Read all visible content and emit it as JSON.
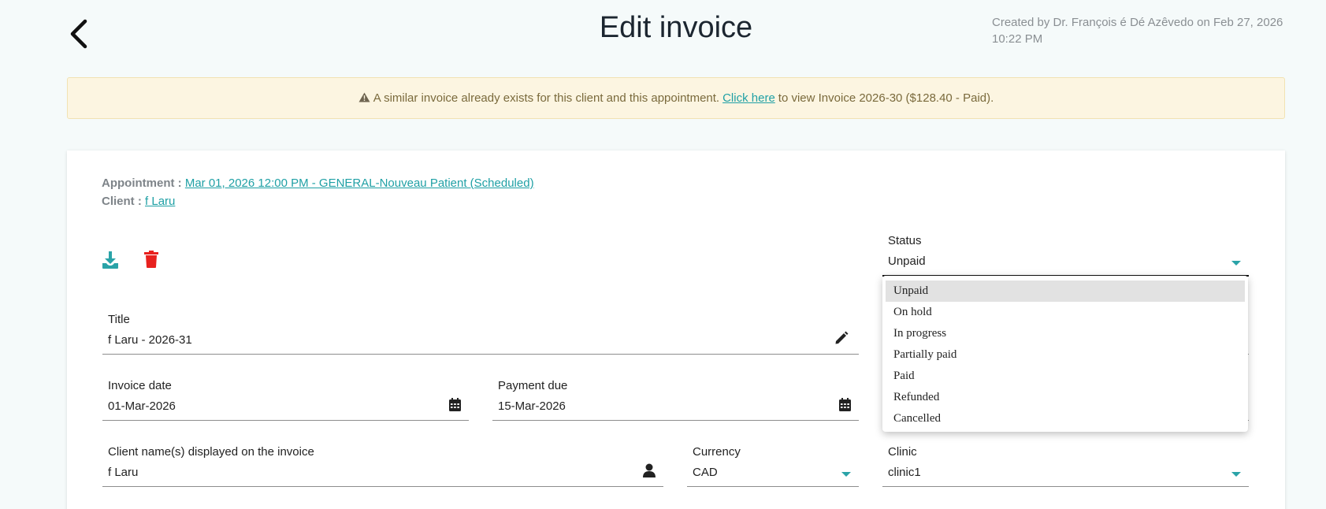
{
  "header": {
    "title": "Edit invoice",
    "created_by_line1": "Created by Dr. François é Dé Azêvedo on Feb 27, 2026",
    "created_by_line2": "10:22 PM"
  },
  "alert": {
    "text_before": "A similar invoice already exists for this client and this appointment.",
    "link": "Click here",
    "text_after": "to view Invoice 2026-30 ($128.40 - Paid)."
  },
  "meta": {
    "appointment_label": "Appointment :",
    "appointment_value": "Mar 01, 2026 12:00 PM - GENERAL-Nouveau Patient (Scheduled)",
    "client_label": "Client :",
    "client_value": "f Laru"
  },
  "form": {
    "status": {
      "label": "Status",
      "value": "Unpaid"
    },
    "title": {
      "label": "Title",
      "value": "f Laru - 2026-31"
    },
    "invoice_date": {
      "label": "Invoice date",
      "value": "01-Mar-2026"
    },
    "payment_due": {
      "label": "Payment due",
      "value": "15-Mar-2026"
    },
    "client_names": {
      "label": "Client name(s) displayed on the invoice",
      "value": "f Laru"
    },
    "currency": {
      "label": "Currency",
      "value": "CAD"
    },
    "clinic": {
      "label": "Clinic",
      "value": "clinic1"
    }
  },
  "status_options": [
    "Unpaid",
    "On hold",
    "In progress",
    "Partially paid",
    "Paid",
    "Refunded",
    "Cancelled"
  ],
  "colors": {
    "accent": "#2aa3a8",
    "danger": "#e8211e",
    "alert_bg": "#fcf5e1"
  }
}
